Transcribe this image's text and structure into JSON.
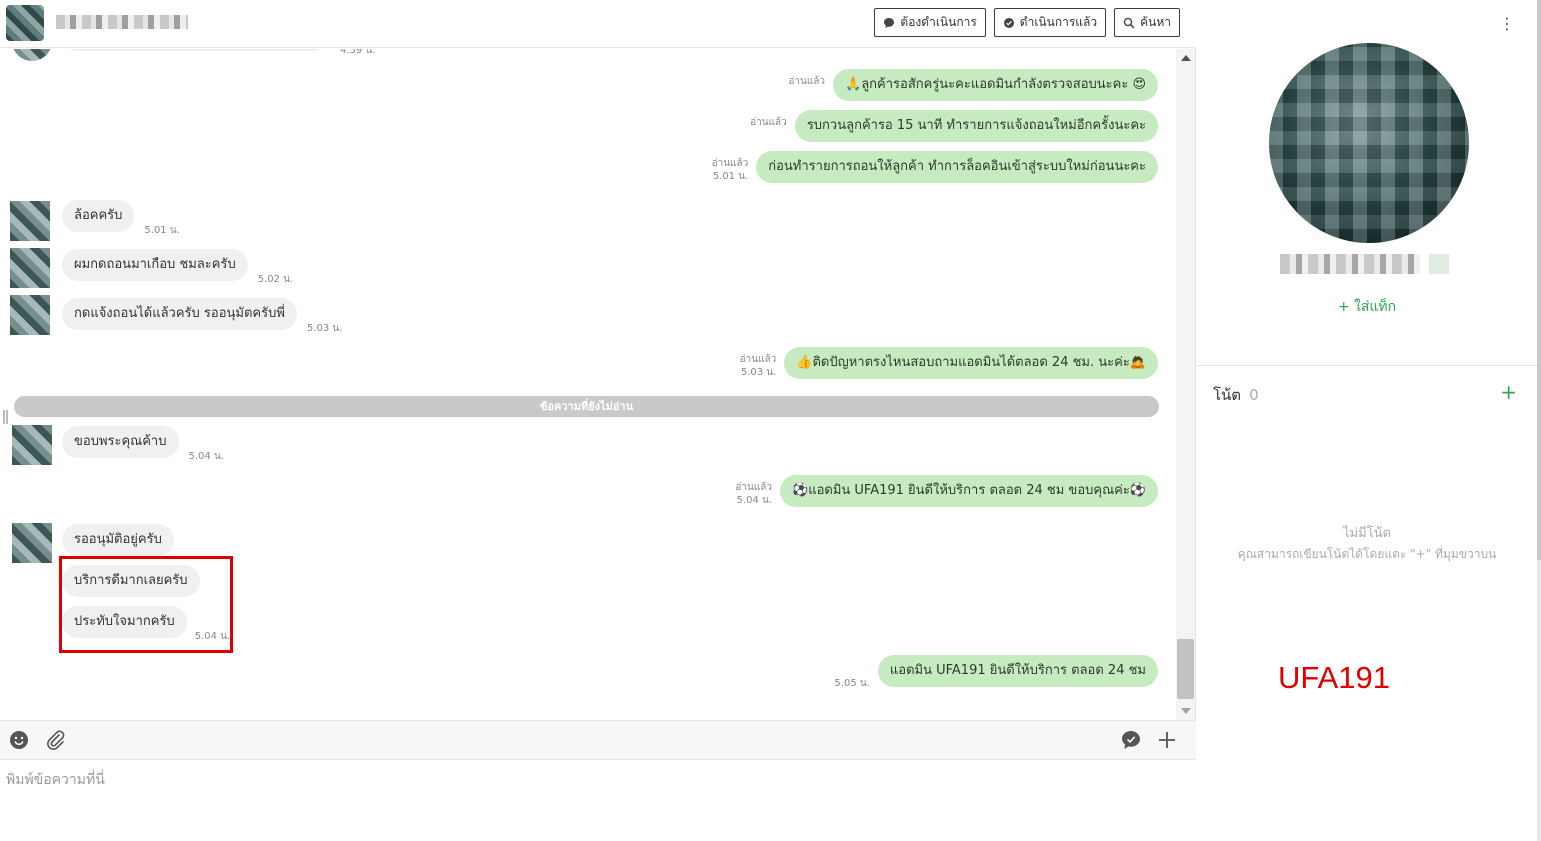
{
  "header": {
    "actions": [
      {
        "label": "ต้องดำเนินการ",
        "icon": "chat-bubble-icon"
      },
      {
        "label": "ดำเนินการแล้ว",
        "icon": "chat-check-icon"
      },
      {
        "label": "ค้นหา",
        "icon": "search-icon"
      }
    ]
  },
  "messages": {
    "partial_time": "4.59 น.",
    "out1": {
      "status": "อ่านแล้ว",
      "text": "🙏ลูกค้ารอสักครู่นะคะแอดมินกำลังตรวจสอบนะคะ 😍"
    },
    "out2": {
      "status": "อ่านแล้ว",
      "text": "รบกวนลูกค้ารอ 15 นาที ทำรายการแจ้งถอนใหม่อีกครั้งนะคะ"
    },
    "out3": {
      "status": "อ่านแล้ว",
      "time": "5.01 น.",
      "text": "ก่อนทำรายการถอนให้ลูกค้า ทำการล็อคอินเข้าสู่ระบบใหม่ก่อนนะคะ"
    },
    "in1": {
      "text": "ล้อคครับ",
      "time": "5.01 น."
    },
    "in2": {
      "text": "ผมกดถอนมาเกือบ ชมละครับ",
      "time": "5.02 น."
    },
    "in3": {
      "text": "กดแจ้งถอนได้แล้วครับ รออนุมัตครับพี่",
      "time": "5.03 น."
    },
    "out4": {
      "status": "อ่านแล้ว",
      "time": "5.03 น.",
      "text": "👍ติดปัญหาตรงไหนสอบถามแอดมินได้ตลอด 24 ชม. นะค่ะ🙇"
    },
    "unread_label": "ข้อความที่ยังไม่อ่าน",
    "in4": {
      "text": "ขอบพระคุณค้าบ",
      "time": "5.04 น."
    },
    "out5": {
      "status": "อ่านแล้ว",
      "time": "5.04 น.",
      "text": "⚽แอดมิน UFA191 ยินดีให้บริการ ตลอด 24 ชม ขอบคุณค่ะ⚽"
    },
    "in5": {
      "text": "รออนุมัติอยู่ครับ"
    },
    "in6": {
      "text": "บริการดีมากเลยครับ"
    },
    "in7": {
      "text": "ประทับใจมากครับ",
      "time": "5.04 น."
    },
    "out6": {
      "time": "5.05 น.",
      "text": "แอดมิน UFA191 ยินดีให้บริการ ตลอด 24 ชม"
    }
  },
  "composer": {
    "placeholder": "พิมพ์ข้อความที่นี่",
    "tools": [
      "emoji-icon",
      "attachment-icon",
      "quick-reply-icon",
      "plus-icon"
    ]
  },
  "sidebar": {
    "add_tag_label": "+ ใส่แท็ก",
    "notes_title": "โน้ต",
    "notes_count": "0",
    "empty_title": "ไม่มีโน้ต",
    "empty_sub": "คุณสามารถเขียนโน้ตได้โดยแตะ \"+\" ที่มุมขวาบน",
    "watermark": "UFA191"
  },
  "colors": {
    "outgoing_bubble": "#c6ebc0",
    "incoming_bubble": "#f0f0f0",
    "accent_green": "#2fa84f",
    "highlight_red": "#e00000"
  }
}
